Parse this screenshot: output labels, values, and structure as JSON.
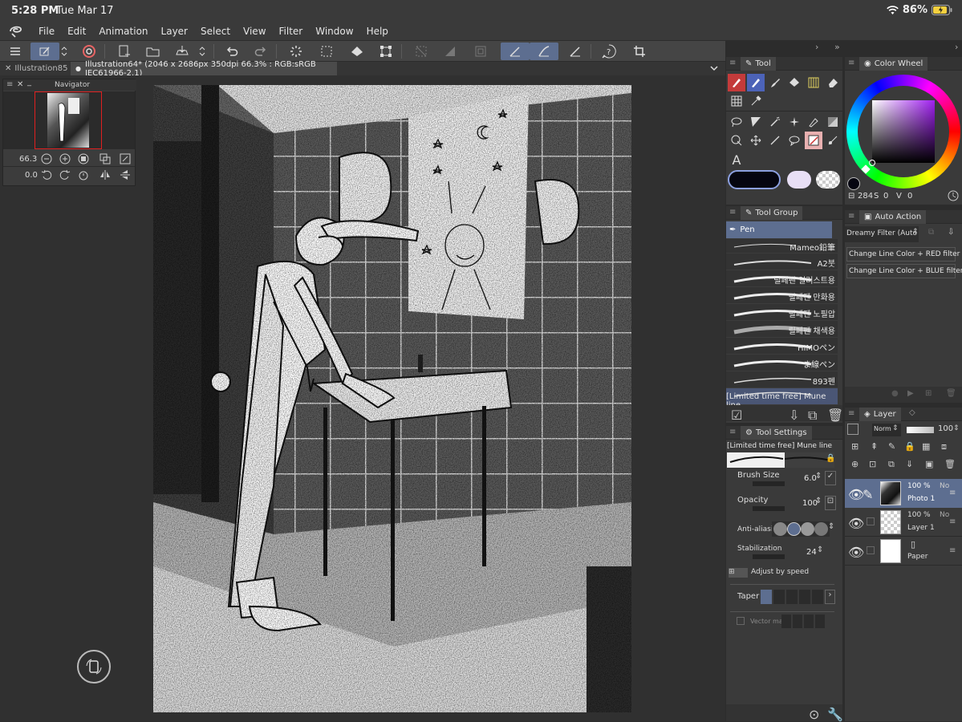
{
  "status_bar": {
    "time": "5:28 PM",
    "date": "Tue Mar 17",
    "battery": "86%"
  },
  "menu": [
    "File",
    "Edit",
    "Animation",
    "Layer",
    "Select",
    "View",
    "Filter",
    "Window",
    "Help"
  ],
  "tabs": [
    {
      "label": "Illustration85",
      "active": false
    },
    {
      "label": "Illustration64* (2046 x 2686px 350dpi 66.3% : RGB:sRGB IEC61966-2.1)",
      "active": true
    }
  ],
  "navigator": {
    "title": "Navigator",
    "zoom": "66.3",
    "rotation": "0.0"
  },
  "tool_panel": {
    "tab": "Tool",
    "text_tool_glyph": "A"
  },
  "color_wheel": {
    "tab": "Color Wheel",
    "h": "284",
    "s_label": "S",
    "s": "0",
    "v_label": "V",
    "v": "0",
    "main_color": "#050510",
    "sub_color": "#e8dff5"
  },
  "auto_action": {
    "tab": "Auto Action",
    "set": "Dreamy Filter (Auto Action)",
    "items": [
      "Change Line Color + RED filter",
      "Change Line Color + BLUE filter"
    ]
  },
  "tool_group": {
    "tab": "Tool Group",
    "active_group": "Pen",
    "brushes": [
      "Mameo鉛筆",
      "A2붓",
      "릴페펜 일러스트용",
      "릴페펜 만화용",
      "릴페펜 노필압",
      "릴페펜 채색용",
      "HIMOペン",
      "ま線ペン",
      "893펜",
      "[Limited time free] Mune line"
    ]
  },
  "tool_settings": {
    "tab": "Tool Settings",
    "brush_name": "[Limited time free] Mune line",
    "brush_size_label": "Brush Size",
    "brush_size": "6.0",
    "opacity_label": "Opacity",
    "opacity": "100",
    "antialias_label": "Anti-aliasing",
    "stabilization_label": "Stabilization",
    "stabilization": "24",
    "adjust_speed_label": "Adjust by speed",
    "taper_label": "Taper",
    "vector_label": "Vector ma"
  },
  "layer_panel": {
    "tab": "Layer",
    "blend_mode": "Norm",
    "opacity": "100",
    "layers": [
      {
        "opacity": "100 %",
        "mode": "No",
        "name": "Photo 1",
        "selected": true
      },
      {
        "opacity": "100 %",
        "mode": "No",
        "name": "Layer 1",
        "selected": false
      },
      {
        "opacity": "",
        "mode": "",
        "name": "Paper",
        "selected": false
      }
    ]
  },
  "colors": {
    "accent": "#5d6e90",
    "panel": "#3a3a3a",
    "workspace": "#303030"
  }
}
